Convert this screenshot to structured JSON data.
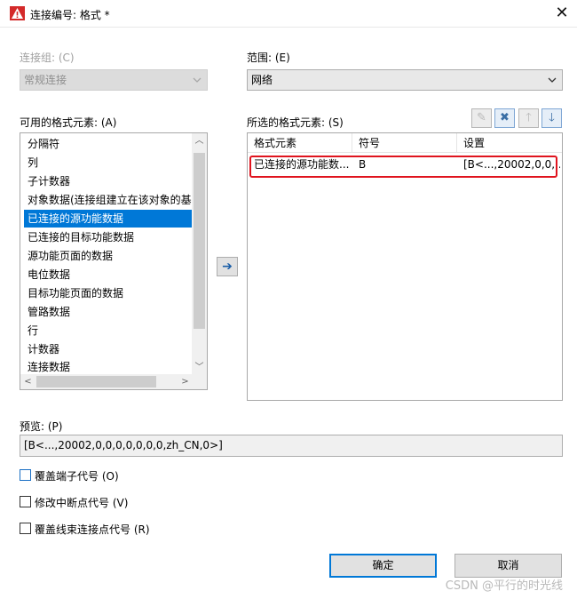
{
  "window": {
    "title": "连接编号: 格式 *",
    "close_glyph": "✕"
  },
  "connection_group": {
    "label": "连接组: (C)",
    "value": "常规连接"
  },
  "scope": {
    "label": "范围: (E)",
    "value": "网络"
  },
  "available": {
    "label": "可用的格式元素: (A)",
    "items": [
      "分隔符",
      "列",
      "子计数器",
      "对象数据(连接组建立在该对象的基",
      "已连接的源功能数据",
      "已连接的目标功能数据",
      "源功能页面的数据",
      "电位数据",
      "目标功能页面的数据",
      "管路数据",
      "行",
      "计数器",
      "连接数据"
    ],
    "selected_index": 4
  },
  "move_right_glyph": "➔",
  "selected_elements": {
    "label": "所选的格式元素: (S)",
    "toolbar": {
      "edit_glyph": "✎",
      "delete_glyph": "✖",
      "up_glyph": "🡑",
      "down_glyph": "🡓"
    },
    "columns": [
      "格式元素",
      "符号",
      "设置"
    ],
    "rows": [
      {
        "element": "已连接的源功能数...",
        "symbol": "B",
        "setting": "[B<...,20002,0,0,..."
      }
    ]
  },
  "preview": {
    "label": "预览: (P)",
    "value": "[B<...,20002,0,0,0,0,0,0,0,zh_CN,0>]"
  },
  "options": [
    {
      "label": "覆盖端子代号 (O)",
      "checked": false
    },
    {
      "label": "修改中断点代号 (V)",
      "checked": false
    },
    {
      "label": "覆盖线束连接点代号 (R)",
      "checked": false
    }
  ],
  "buttons": {
    "ok": "确定",
    "cancel": "取消"
  },
  "watermark": "CSDN @平行的时光线",
  "colors": {
    "selection": "#0078d7",
    "highlight_box": "#e0141e",
    "app_icon": "#d42a2a"
  }
}
